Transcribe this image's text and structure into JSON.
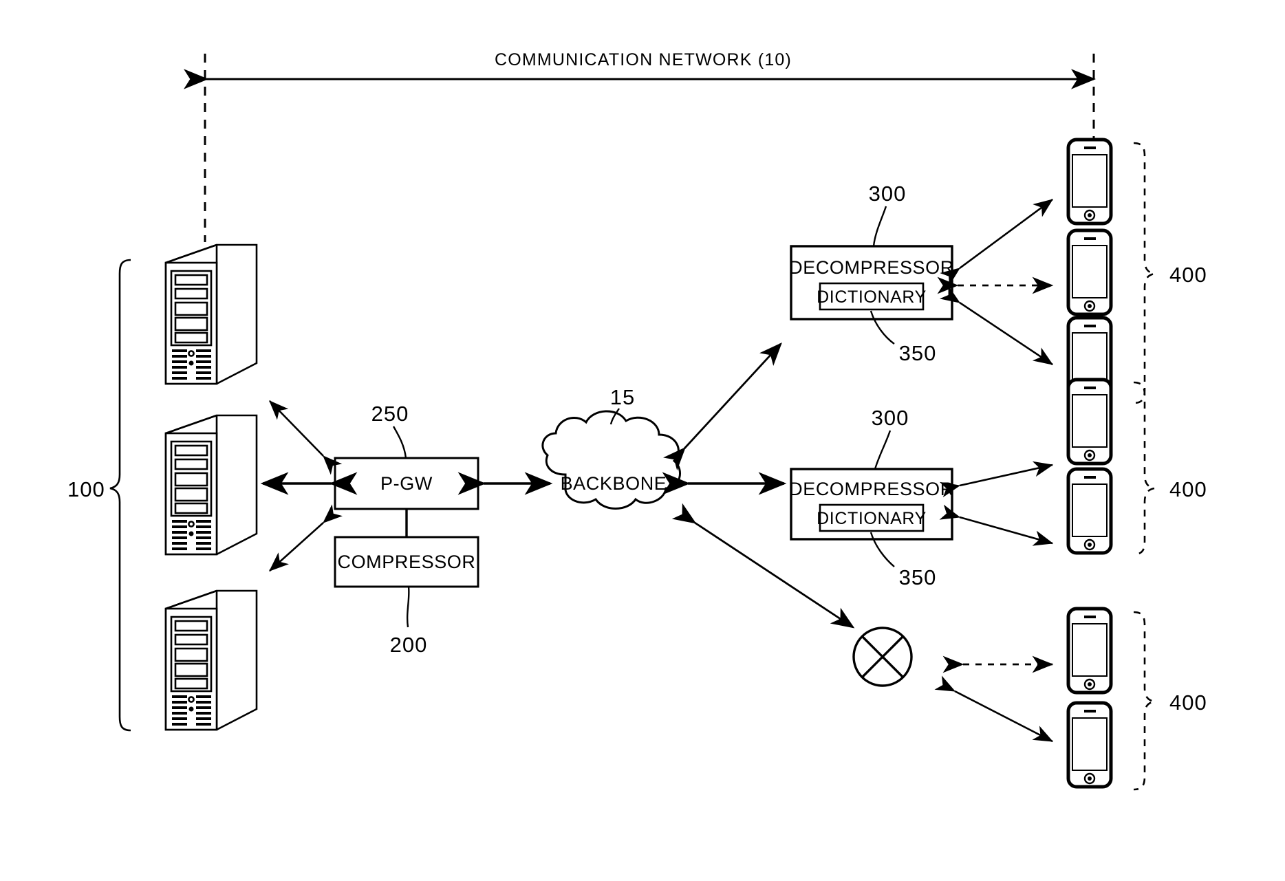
{
  "figure": {
    "title": "COMMUNICATION NETWORK (10)",
    "type": "patent-network-diagram"
  },
  "header": {
    "network_label": "COMMUNICATION NETWORK (10)"
  },
  "nodes": {
    "servers": {
      "ref": "100",
      "count": 3,
      "icon": "server-tower-icon"
    },
    "pgw": {
      "label": "P-GW",
      "ref": "250"
    },
    "compressor": {
      "label": "COMPRESSOR",
      "ref": "200"
    },
    "backbone": {
      "label": "BACKBONE",
      "ref": "15",
      "icon": "cloud-icon"
    },
    "decompressor_top": {
      "label": "DECOMPRESSOR",
      "ref": "300",
      "dictionary_label": "DICTIONARY",
      "dictionary_ref": "350"
    },
    "decompressor_middle": {
      "label": "DECOMPRESSOR",
      "ref": "300",
      "dictionary_label": "DICTIONARY",
      "dictionary_ref": "350"
    },
    "blocked_node": {
      "icon": "circled-x-icon",
      "label": ""
    },
    "terminal_group_top": {
      "ref": "400",
      "count": 3,
      "icon": "smartphone-icon"
    },
    "terminal_group_middle": {
      "ref": "400",
      "count": 2,
      "icon": "smartphone-icon"
    },
    "terminal_group_bottom": {
      "ref": "400",
      "count": 2,
      "icon": "smartphone-icon"
    }
  },
  "colors": {
    "stroke": "#000000",
    "background": "#ffffff"
  }
}
